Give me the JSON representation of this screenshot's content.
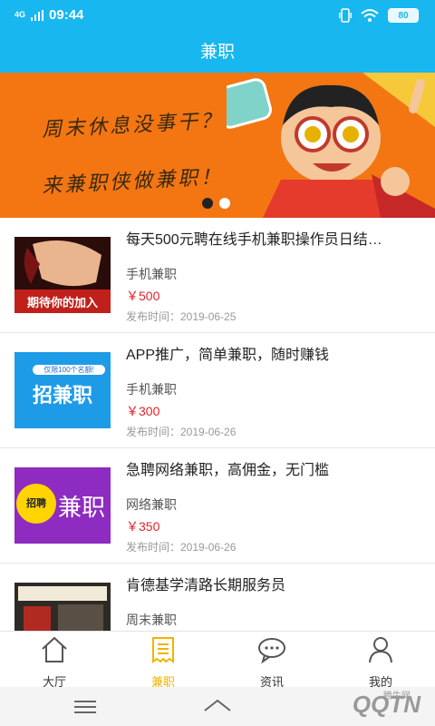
{
  "status": {
    "signal": "4G",
    "time": "09:44",
    "battery": "80"
  },
  "app": {
    "title": "兼职"
  },
  "banner": {
    "line1": "周末休息没事干？",
    "line2": "来兼职侠做兼职！",
    "slide_count": 2,
    "active_slide": 0
  },
  "jobs": [
    {
      "title": "每天500元聘在线手机兼职操作员日结…",
      "category": "手机兼职",
      "price": "￥500",
      "date": "发布时间：2019-06-25",
      "thumb_text": "期待你的加入"
    },
    {
      "title": "APP推广，简单兼职，随时赚钱",
      "category": "手机兼职",
      "price": "￥300",
      "date": "发布时间：2019-06-26",
      "thumb_text": "招兼职",
      "thumb_sub": "仅限100个名额!"
    },
    {
      "title": "急聘网络兼职，高佣金，无门槛",
      "category": "网络兼职",
      "price": "￥350",
      "date": "发布时间：2019-06-26",
      "thumb_text": "兼职",
      "thumb_badge": "招聘"
    },
    {
      "title": "肯德基学清路长期服务员",
      "category": "周末兼职",
      "price": "",
      "date": ""
    }
  ],
  "tabs": [
    {
      "label": "大厅",
      "icon": "home-icon"
    },
    {
      "label": "兼职",
      "icon": "receipt-icon",
      "active": true
    },
    {
      "label": "资讯",
      "icon": "chat-icon"
    },
    {
      "label": "我的",
      "icon": "user-icon"
    }
  ],
  "watermark": {
    "text": "QQTN",
    "sub": "腾牛网"
  },
  "colors": {
    "primary": "#18b7f0",
    "banner": "#f37612",
    "price": "#e0242b",
    "active_tab": "#f0b400"
  }
}
